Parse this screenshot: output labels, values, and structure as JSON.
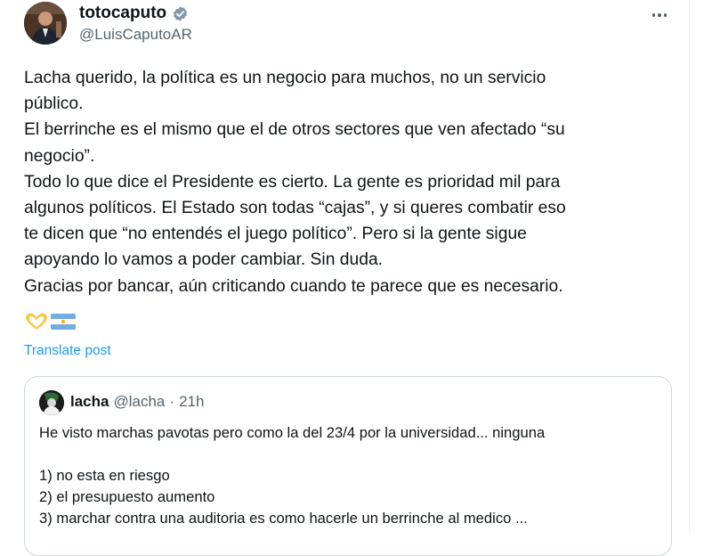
{
  "author": {
    "display_name": "totocaputo",
    "handle": "@LuisCaputoAR",
    "verified": true,
    "avatar_icon": "profile-photo"
  },
  "menu": {
    "icon": "more-horizontal-icon"
  },
  "tweet": {
    "lines": [
      "Lacha querido, la política es un negocio para muchos, no un servicio",
      "público.",
      "El berrinche es el mismo que el de otros sectores que ven afectado “su",
      "negocio”.",
      "Todo lo que dice el Presidente es cierto. La gente es prioridad mil para",
      "algunos políticos. El Estado son todas “cajas”, y si queres combatir eso",
      "te dicen que “no entendés el juego político”. Pero si la gente sigue",
      "apoyando lo vamos a poder cambiar. Sin duda.",
      "Gracias por bancar, aún criticando cuando te parece que es necesario."
    ],
    "emojis": [
      "heart-hands-emoji",
      "argentina-flag-emoji"
    ],
    "translate_label": "Translate post"
  },
  "quote": {
    "display_name": "lacha",
    "handle": "@lacha",
    "separator": "·",
    "time": "21h",
    "lines": [
      "He visto marchas pavotas pero como la del 23/4 por la universidad... ninguna",
      "",
      "1) no esta en riesgo",
      "2) el presupuesto aumento",
      "3) marchar contra una auditoria es como hacerle un berrinche al medico ..."
    ]
  },
  "colors": {
    "text": "#0f1419",
    "secondary": "#536471",
    "link": "#1d9bf0",
    "border": "#cfd9de"
  }
}
